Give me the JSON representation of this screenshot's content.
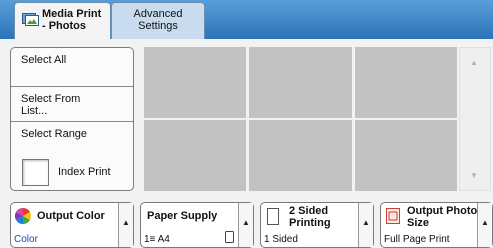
{
  "tabs": {
    "media_print": {
      "line1": "Media Print",
      "line2": "- Photos"
    },
    "advanced": {
      "line1": "Advanced",
      "line2": "Settings"
    }
  },
  "left_buttons": {
    "select_all": "Select All",
    "select_from_list": {
      "line1": "Select From",
      "line2": "List..."
    },
    "select_range": "Select Range"
  },
  "index_print": {
    "label": "Index Print"
  },
  "scroll": {
    "up": "▲",
    "down": "▼"
  },
  "feature_buttons": {
    "output_color": {
      "title": "Output Color",
      "value": "Color"
    },
    "paper_supply": {
      "title": "Paper Supply",
      "value": "1≡ A4"
    },
    "two_sided": {
      "line1": "2 Sided",
      "line2": "Printing",
      "value": "1 Sided"
    },
    "output_photo_size": {
      "line1": "Output Photo",
      "line2": "Size",
      "value": "Full Page Print"
    }
  },
  "icons": {
    "media_tab": "photo-print-icon",
    "color": "color-wheel-icon",
    "two_sided": "paper-sheet-icon",
    "photo_size": "photo-size-icon",
    "tray": "paper-tray-icon",
    "arrow": "arrow-up-icon"
  },
  "colors": {
    "tab_bar": "#2d73b8",
    "accent_text": "#1a47b0",
    "thumb": "#c2c2c2"
  }
}
